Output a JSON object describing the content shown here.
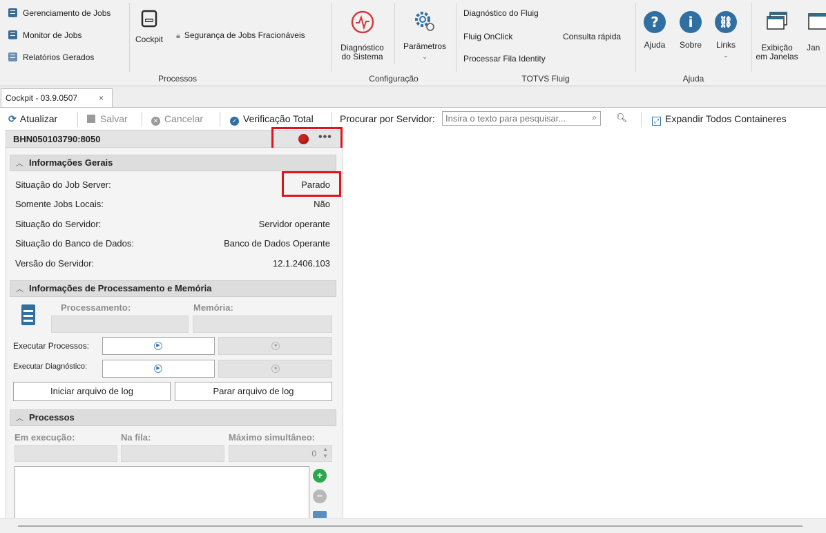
{
  "ribbon": {
    "processos_items": [
      "Gerenciamento de Jobs",
      "Monitor de Jobs",
      "Relatórios Gerados"
    ],
    "cockpit_label": "Cockpit",
    "seguranca_label": "Segurança de Jobs Fracionáveis",
    "group_processos": "Processos",
    "diagnostico_label_1": "Diagnóstico",
    "diagnostico_label_2": "do Sistema",
    "parametros_label": "Parâmetros",
    "group_configuracao": "Configuração",
    "fluig_items": [
      "Diagnóstico do Fluig",
      "Fluig OnClick",
      "Processar Fila Identity"
    ],
    "consulta_label": "Consulta rápida",
    "group_totvs": "TOTVS Fluig",
    "ajuda_label": "Ajuda",
    "sobre_label": "Sobre",
    "links_label": "Links",
    "group_ajuda": "Ajuda",
    "exibicao_label_1": "Exibição",
    "exibicao_label_2": "em Janelas",
    "janelas_label": "Jan"
  },
  "tab": {
    "label": "Cockpit - 03.9.0507",
    "close": "×"
  },
  "toolbar": {
    "atualizar": "Atualizar",
    "salvar": "Salvar",
    "cancelar": "Cancelar",
    "verificacao": "Verificação Total",
    "procurar_label": "Procurar por Servidor:",
    "search_placeholder": "Insira o texto para pesquisar...",
    "expandir": "Expandir Todos Containeres"
  },
  "server": {
    "name": "BHN050103790:8050",
    "status_color": "#c9211e"
  },
  "info_gerais": {
    "title": "Informações Gerais",
    "rows": [
      {
        "label": "Situação do Job Server:",
        "value": "Parado"
      },
      {
        "label": "Somente Jobs Locais:",
        "value": "Não"
      },
      {
        "label": "Situação do Servidor:",
        "value": "Servidor operante"
      },
      {
        "label": "Situação do Banco de Dados:",
        "value": "Banco de Dados Operante"
      },
      {
        "label": "Versão do Servidor:",
        "value": "12.1.2406.103"
      }
    ]
  },
  "proc_mem": {
    "title": "Informações de Processamento e Memória",
    "processamento": "Processamento:",
    "memoria": "Memória:",
    "executar_processos": "Executar Processos:",
    "executar_diagnostico": "Executar Diagnóstico:",
    "iniciar_log": "Iniciar arquivo de log",
    "parar_log": "Parar arquivo de log"
  },
  "processos": {
    "title": "Processos",
    "em_execucao": "Em execução:",
    "na_fila": "Na fila:",
    "maximo": "Máximo simultâneo:",
    "maximo_value": "0"
  }
}
